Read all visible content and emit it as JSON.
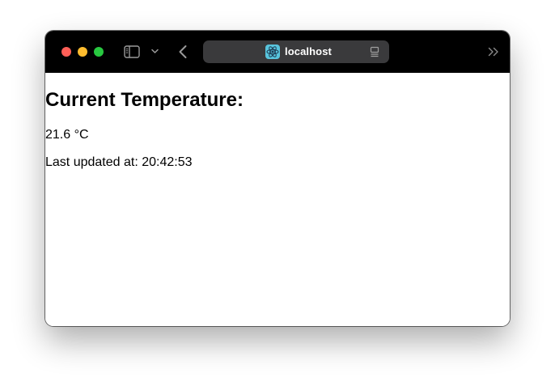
{
  "browser": {
    "url": "localhost",
    "colors": {
      "titlebar": "#000000",
      "urlbar": "#3a3a3c",
      "close": "#ff5f57",
      "minimize": "#febc2e",
      "zoom": "#28c840",
      "favicon": "#58c4dc"
    },
    "icons": [
      "sidebar-icon",
      "chevron-down-icon",
      "back-icon",
      "react-icon",
      "reader-icon",
      "overflow-icon"
    ]
  },
  "page": {
    "heading": "Current Temperature:",
    "temperature": "21.6 °C",
    "updated_label": "Last updated at:",
    "updated_time": "20:42:53"
  }
}
